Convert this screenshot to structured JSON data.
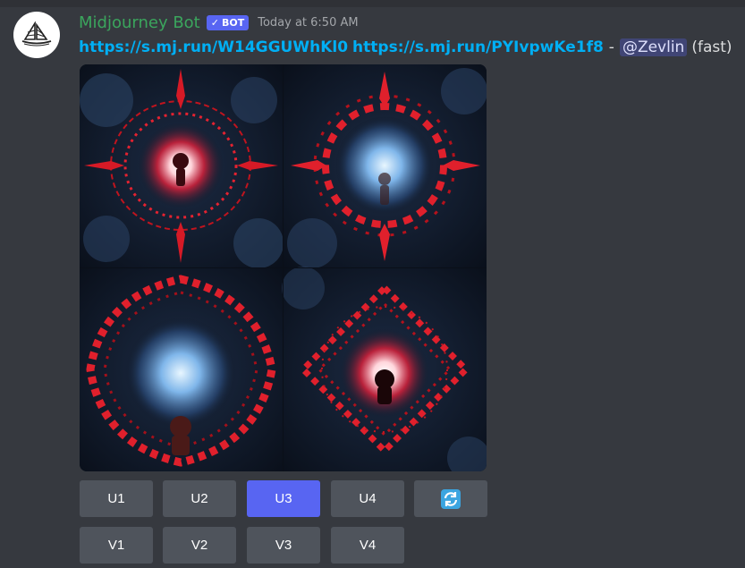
{
  "message": {
    "username": "Midjourney Bot",
    "badge": "BOT",
    "badge_check": "✓",
    "timestamp": "Today at 6:50 AM",
    "link1": "https://s.mj.run/W14GGUWhKl0",
    "link2": "https://s.mj.run/PYIvpwKe1f8",
    "separator": "-",
    "mention": "@Zevlin",
    "speed": "(fast)"
  },
  "buttons": {
    "row1": [
      "U1",
      "U2",
      "U3",
      "U4"
    ],
    "row2": [
      "V1",
      "V2",
      "V3",
      "V4"
    ],
    "selected": "U3",
    "reroll_icon": "refresh-icon"
  },
  "colors": {
    "username": "#3ba55d",
    "link": "#00aff4",
    "button": "#4f545c",
    "button_selected": "#5865f2",
    "badge": "#5865f2",
    "background": "#36393f"
  }
}
